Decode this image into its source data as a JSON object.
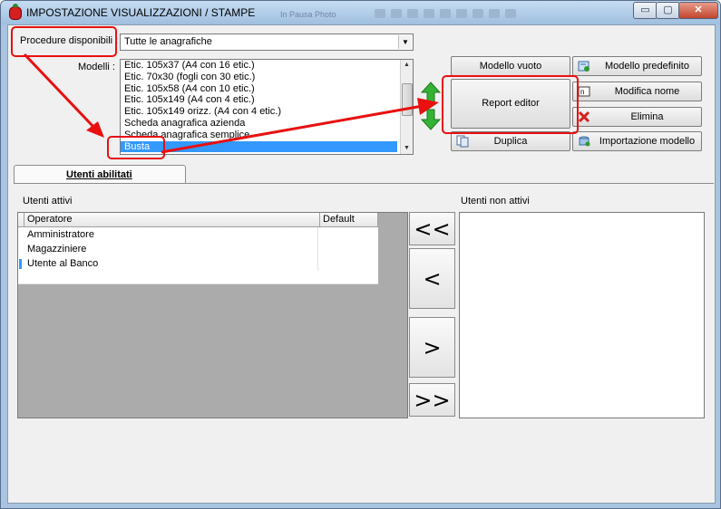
{
  "window": {
    "title": "IMPOSTAZIONE VISUALIZZAZIONI / STAMPE",
    "background_text": "In Pausa Photo",
    "controls": {
      "minimize": "▭",
      "maximize": "▢",
      "close": "✕"
    }
  },
  "procedure": {
    "label": "Procedure disponibili :",
    "selected": "Tutte le anagrafiche"
  },
  "modelli": {
    "label": "Modelli :",
    "items": [
      "Etic. 105x37 (A4 con 16 etic.)",
      "Etic. 70x30 (fogli con 30 etic.)",
      "Etic. 105x58 (A4 con 10 etic.)",
      "Etic. 105x149 (A4 con 4 etic.)",
      "Etic. 105x149 orizz. (A4 con 4 etic.)",
      "Scheda anagrafica azienda",
      "Scheda anagrafica semplice",
      "Busta"
    ],
    "selected_index": 7
  },
  "buttons": {
    "modello_vuoto": "Modello vuoto",
    "report_editor": "Report editor",
    "duplica": "Duplica",
    "modello_predefinito": "Modello predefinito",
    "modifica_nome": "Modifica nome",
    "elimina": "Elimina",
    "importazione_modello": "Importazione modello"
  },
  "tab": {
    "label": "Utenti abilitati"
  },
  "utenti_attivi": {
    "label": "Utenti attivi",
    "columns": [
      "Operatore",
      "Default"
    ],
    "rows": [
      {
        "operatore": "Amministratore",
        "default": ""
      },
      {
        "operatore": "Magazziniere",
        "default": ""
      },
      {
        "operatore": "Utente al Banco",
        "default": ""
      }
    ],
    "current_row": 2
  },
  "utenti_non_attivi": {
    "label": "Utenti non attivi"
  },
  "move_buttons": {
    "all_left": "<<",
    "left": "<",
    "right": ">",
    "all_right": ">>"
  },
  "colors": {
    "selection": "#3399ff",
    "annotation_red": "#e81010",
    "grid_empty": "#ababab",
    "green_arrow": "#33b233"
  }
}
